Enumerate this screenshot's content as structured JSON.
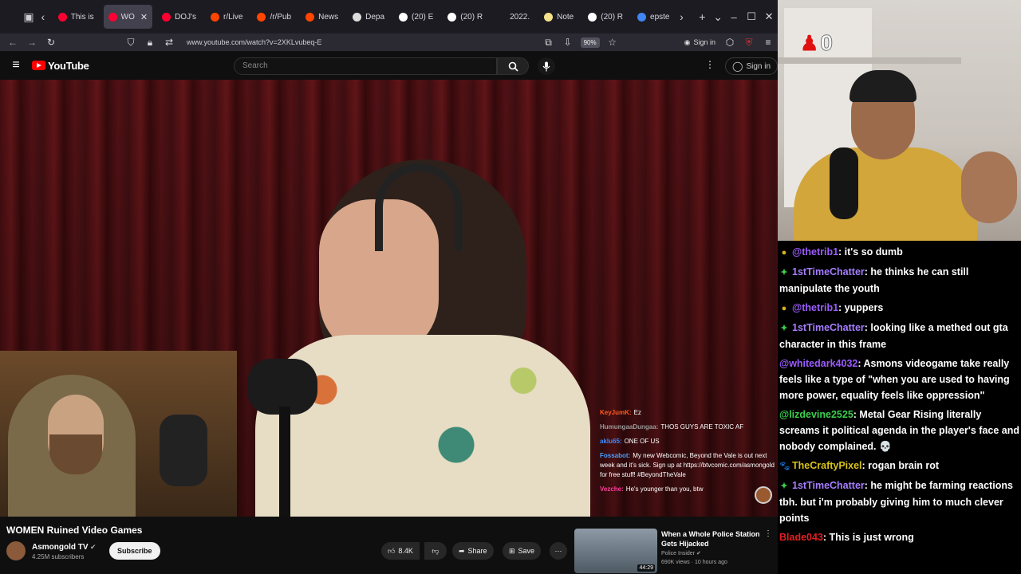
{
  "browser": {
    "tabs": [
      {
        "label": "This is",
        "color": "#ff0033",
        "active": false
      },
      {
        "label": "WO",
        "color": "#ff0033",
        "active": true
      },
      {
        "label": "DOJ's",
        "color": "#ff0033",
        "active": false
      },
      {
        "label": "r/Live",
        "color": "#ff4500",
        "active": false
      },
      {
        "label": "/r/Pub",
        "color": "#ff4500",
        "active": false
      },
      {
        "label": "News",
        "color": "#ff4500",
        "active": false
      },
      {
        "label": "Depa",
        "color": "#dddddd",
        "active": false
      },
      {
        "label": "(20) E",
        "color": "#ffffff",
        "active": false
      },
      {
        "label": "(20) R",
        "color": "#ffffff",
        "active": false
      },
      {
        "label": "2022.",
        "color": "#1c1b22",
        "active": false
      },
      {
        "label": "Note",
        "color": "#f5e28a",
        "active": false
      },
      {
        "label": "(20) R",
        "color": "#ffffff",
        "active": false
      },
      {
        "label": "epste",
        "color": "#4285f4",
        "active": false
      }
    ],
    "url": "www.youtube.com/watch?v=2XKLvubeq-E",
    "zoom": "90%",
    "sign_in": "Sign in"
  },
  "youtube": {
    "logo": "YouTube",
    "search_placeholder": "Search",
    "sign_in": "Sign in"
  },
  "video": {
    "title": "WOMEN Ruined Video Games",
    "channel": "Asmongold TV",
    "subscribers": "4.25M subscribers",
    "subscribe_label": "Subscribe",
    "likes": "8.4K",
    "share_label": "Share",
    "save_label": "Save"
  },
  "video_chat": [
    {
      "name": "KeyJumK:",
      "color": "#ff5a1f",
      "text": "Ez"
    },
    {
      "name": "HumungaaDungaa:",
      "color": "#9a9a9a",
      "text": "THOS GUYS ARE TOXIC AF"
    },
    {
      "name": "aklu65:",
      "color": "#3d8bff",
      "text": "ONE OF US"
    },
    {
      "name": "Fossabot:",
      "color": "#4a9fff",
      "text": "My new Webcomic, Beyond the Vale is out next week and it's sick. Sign up at https://btvcomic.com/asmongold for free stuff! #BeyondTheVale"
    },
    {
      "name": "Vezche:",
      "color": "#ff3c9e",
      "text": "He's younger than you, btw"
    }
  ],
  "recommendation": {
    "title": "When a Whole Police Station Gets Hijacked",
    "channel": "Police Insider",
    "meta": "690K views · 10 hours ago",
    "duration": "44:29"
  },
  "stream_counter": "0",
  "chat": [
    {
      "badge": "●",
      "badge_color": "#d8b21a",
      "name": "@thetrib1",
      "name_color": "#9b5cff",
      "text": ": it's so dumb"
    },
    {
      "badge": "✦",
      "badge_color": "#3ccf4e",
      "name": "1stTimeChatter",
      "name_color": "#a57eff",
      "text": ": he thinks he can still manipulate the youth"
    },
    {
      "badge": "●",
      "badge_color": "#d8b21a",
      "name": "@thetrib1",
      "name_color": "#9b5cff",
      "text": ": yuppers"
    },
    {
      "badge": "✦",
      "badge_color": "#3ccf4e",
      "name": "1stTimeChatter",
      "name_color": "#a57eff",
      "text": ": looking like a methed out gta character in this frame"
    },
    {
      "badge": "",
      "badge_color": "#000000",
      "name": "@whitedark4032",
      "name_color": "#9b5cff",
      "text": ": Asmons videogame take really feels like a type of \"when you are used to having more power, equality feels like oppression\""
    },
    {
      "badge": "",
      "badge_color": "#000000",
      "name": "@lizdevine2525",
      "name_color": "#3ccf4e",
      "text": ": Metal Gear Rising literally screams it political agenda in the player's face and nobody complained. 💀"
    },
    {
      "badge": "🐾",
      "badge_color": "#bbbbbb",
      "name": "TheCraftyPixel",
      "name_color": "#d8c21a",
      "text": ": rogan brain rot"
    },
    {
      "badge": "✦",
      "badge_color": "#3ccf4e",
      "name": "1stTimeChatter",
      "name_color": "#a57eff",
      "text": ": he might be farming reactions tbh. but i'm probably giving him to much clever points"
    },
    {
      "badge": "",
      "badge_color": "#000000",
      "name": "Blade043",
      "name_color": "#e02020",
      "text": ": This is just wrong"
    }
  ]
}
